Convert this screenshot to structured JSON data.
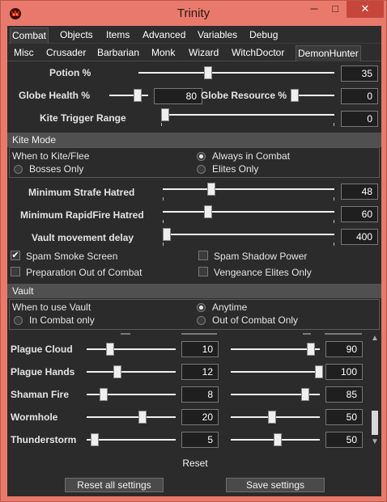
{
  "window": {
    "title": "Trinity",
    "min_glyph": "─",
    "max_glyph": "□",
    "close_glyph": "✕"
  },
  "tabs_row1": [
    "Combat",
    "Objects",
    "Items",
    "Advanced",
    "Variables",
    "Debug"
  ],
  "tabs_row2": [
    "Misc",
    "Crusader",
    "Barbarian",
    "Monk",
    "Wizard",
    "WitchDoctor",
    "DemonHunter"
  ],
  "selected_tab_row1": "Combat",
  "selected_tab_row2": "DemonHunter",
  "settings": {
    "potion": {
      "label": "Potion %",
      "value": "35",
      "level": 0.35
    },
    "globe_health": {
      "label": "Globe Health %",
      "value": "80",
      "level": 0.8
    },
    "globe_resource": {
      "label": "Globe Resource %",
      "value": "0",
      "level": 0
    },
    "kite_range": {
      "label": "Kite Trigger Range",
      "value": "0",
      "level": 0
    }
  },
  "kite_mode": {
    "header": "Kite Mode",
    "question": "When to Kite/Flee",
    "options": [
      {
        "label": "Always in Combat",
        "selected": true
      },
      {
        "label": "Bosses Only",
        "selected": false
      },
      {
        "label": "Elites Only",
        "selected": false
      }
    ]
  },
  "hatred": {
    "strafe": {
      "label": "Minimum Strafe Hatred",
      "value": "48",
      "level": 0.27
    },
    "rapidfire": {
      "label": "Minimum RapidFire Hatred",
      "value": "60",
      "level": 0.25
    },
    "vault_delay": {
      "label": "Vault movement delay",
      "value": "400",
      "level": 0
    }
  },
  "checkboxes": {
    "spam_smoke": {
      "label": "Spam Smoke Screen",
      "checked": true,
      "mark": "✔"
    },
    "spam_shadow": {
      "label": "Spam Shadow Power",
      "checked": false
    },
    "prep_ooc": {
      "label": "Preparation Out of Combat",
      "checked": false
    },
    "veng_elites": {
      "label": "Vengeance Elites Only",
      "checked": false
    }
  },
  "vault": {
    "header": "Vault",
    "question": "When to use Vault",
    "options": [
      {
        "label": "Anytime",
        "selected": true
      },
      {
        "label": "In Combat only",
        "selected": false
      },
      {
        "label": "Out of Combat Only",
        "selected": false
      }
    ]
  },
  "avoidance": [
    {
      "label": "Plague Cloud",
      "value1": "10",
      "value2": "90"
    },
    {
      "label": "Plague Hands",
      "value1": "12",
      "value2": "100"
    },
    {
      "label": "Shaman Fire",
      "value1": "8",
      "value2": "85"
    },
    {
      "label": "Wormhole",
      "value1": "20",
      "value2": "50"
    },
    {
      "label": "Thunderstorm",
      "value1": "5",
      "value2": "50"
    }
  ],
  "scroll": {
    "up_glyph": "▲",
    "down_glyph": "▼"
  },
  "buttons": {
    "reset": "Reset",
    "reset_all": "Reset all settings",
    "save": "Save settings"
  }
}
